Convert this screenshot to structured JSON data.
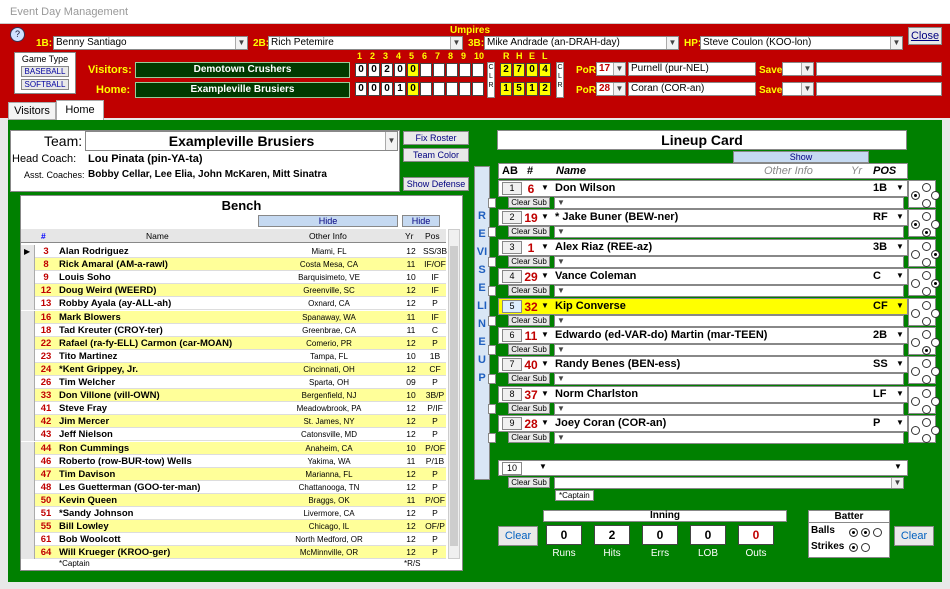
{
  "window_title": "Event Day Management",
  "umpires": {
    "header": "Umpires",
    "first_label": "1B:",
    "first": "Benny Santiago",
    "second_label": "2B:",
    "second": "Rich Petemire",
    "third_label": "3B:",
    "third": "Mike Andrade (an-DRAH-day)",
    "home_label": "HP:",
    "home": "Steve Coulon (KOO-lon)"
  },
  "close_label": "Close",
  "game_type": {
    "title": "Game Type",
    "options": [
      "BASEBALL",
      "SOFTBALL"
    ]
  },
  "scoreboard": {
    "inning_headers": [
      "1",
      "2",
      "3",
      "4",
      "5",
      "6",
      "7",
      "8",
      "9",
      "10"
    ],
    "rhel_headers": [
      "R",
      "H",
      "E",
      "L"
    ],
    "clr": "C L R",
    "visitors_label": "Visitors:",
    "visitors_team": "Demotown Crushers",
    "visitors_innings": [
      "0",
      "0",
      "2",
      "0",
      "0",
      "",
      "",
      "",
      "",
      ""
    ],
    "visitors_rhel": [
      "2",
      "7",
      "0",
      "4"
    ],
    "home_label": "Home:",
    "home_team": "Exampleville Brusiers",
    "home_innings": [
      "0",
      "0",
      "0",
      "1",
      "0",
      "",
      "",
      "",
      "",
      ""
    ],
    "home_rhel": [
      "1",
      "5",
      "1",
      "2"
    ],
    "por_label": "PoR:",
    "save_label": "Save:",
    "visitors_por_num": "17",
    "visitors_por_name": "Purnell (pur-NEL)",
    "home_por_num": "28",
    "home_por_name": "Coran (COR-an)"
  },
  "tabs": [
    "Visitors",
    "Home"
  ],
  "team": {
    "label": "Team:",
    "name": "Exampleville Brusiers",
    "head_coach_label": "Head Coach:",
    "head_coach": "Lou Pinata (pin-YA-ta)",
    "asst_label": "Asst. Coaches:",
    "asst": "Bobby Cellar, Lee Elia, John McKaren, Mitt Sinatra"
  },
  "buttons": {
    "fix_roster": "Fix Roster",
    "team_color": "Team Color",
    "show_defense": "Show Defense",
    "hide": "Hide",
    "show": "Show",
    "clear": "Clear",
    "clear_sub": "Clear Sub"
  },
  "bench": {
    "title": "Bench",
    "headers": [
      "#",
      "Name",
      "Other Info",
      "Yr",
      "Pos"
    ],
    "footer_left": "*Captain",
    "footer_right": "*R/S",
    "rows": [
      {
        "num": "3",
        "name": "Alan Rodriguez",
        "info": "Miami, FL",
        "yr": "12",
        "pos": "SS/3B",
        "hl": false
      },
      {
        "num": "8",
        "name": "Rick Amaral (AM-a-rawl)",
        "info": "Costa Mesa, CA",
        "yr": "11",
        "pos": "IF/OF",
        "hl": true
      },
      {
        "num": "9",
        "name": "Louis Soho",
        "info": "Barquisimeto, VE",
        "yr": "10",
        "pos": "IF",
        "hl": false
      },
      {
        "num": "12",
        "name": "Doug Weird (WEERD)",
        "info": "Greenville, SC",
        "yr": "12",
        "pos": "IF",
        "hl": true
      },
      {
        "num": "13",
        "name": "Robby Ayala (ay-ALL-ah)",
        "info": "Oxnard, CA",
        "yr": "12",
        "pos": "P",
        "hl": false
      },
      {
        "num": "16",
        "name": "Mark Blowers",
        "info": "Spanaway, WA",
        "yr": "11",
        "pos": "IF",
        "hl": true
      },
      {
        "num": "18",
        "name": "Tad Kreuter (CROY-ter)",
        "info": "Greenbrae, CA",
        "yr": "11",
        "pos": "C",
        "hl": false
      },
      {
        "num": "22",
        "name": "Rafael (ra-fy-ELL) Carmon (car-MOAN)",
        "info": "Comerio, PR",
        "yr": "12",
        "pos": "P",
        "hl": true
      },
      {
        "num": "23",
        "name": "Tito Martinez",
        "info": "Tampa, FL",
        "yr": "10",
        "pos": "1B",
        "hl": false
      },
      {
        "num": "24",
        "name": "*Kent Grippey, Jr.",
        "info": "Cincinnati, OH",
        "yr": "12",
        "pos": "CF",
        "hl": true
      },
      {
        "num": "26",
        "name": "Tim Welcher",
        "info": "Sparta, OH",
        "yr": "09",
        "pos": "P",
        "hl": false
      },
      {
        "num": "33",
        "name": "Don Villone (vill-OWN)",
        "info": "Bergenfield, NJ",
        "yr": "10",
        "pos": "3B/P",
        "hl": true
      },
      {
        "num": "41",
        "name": "Steve Fray",
        "info": "Meadowbrook, PA",
        "yr": "12",
        "pos": "P/IF",
        "hl": false
      },
      {
        "num": "42",
        "name": "Jim Mercer",
        "info": "St. James, NY",
        "yr": "12",
        "pos": "P",
        "hl": true
      },
      {
        "num": "43",
        "name": "Jeff Nielson",
        "info": "Catonsville, MD",
        "yr": "12",
        "pos": "P",
        "hl": false
      },
      {
        "num": "44",
        "name": "Ron Cummings",
        "info": "Anaheim, CA",
        "yr": "10",
        "pos": "P/OF",
        "hl": true
      },
      {
        "num": "46",
        "name": "Roberto (row-BUR-tow) Wells",
        "info": "Yakima, WA",
        "yr": "11",
        "pos": "P/1B",
        "hl": false
      },
      {
        "num": "47",
        "name": "Tim Davison",
        "info": "Marianna, FL",
        "yr": "12",
        "pos": "P",
        "hl": true
      },
      {
        "num": "48",
        "name": "Les Guetterman (GOO-ter-man)",
        "info": "Chattanooga, TN",
        "yr": "12",
        "pos": "P",
        "hl": false
      },
      {
        "num": "50",
        "name": "Kevin Queen",
        "info": "Braggs, OK",
        "yr": "11",
        "pos": "P/OF",
        "hl": true
      },
      {
        "num": "51",
        "name": "*Sandy Johnson",
        "info": "Livermore, CA",
        "yr": "12",
        "pos": "P",
        "hl": false
      },
      {
        "num": "55",
        "name": "Bill Lowley",
        "info": "Chicago, IL",
        "yr": "12",
        "pos": "OF/P",
        "hl": true
      },
      {
        "num": "61",
        "name": "Bob Woolcott",
        "info": "North Medford, OR",
        "yr": "12",
        "pos": "P",
        "hl": false
      },
      {
        "num": "64",
        "name": "Will Krueger (KROO-ger)",
        "info": "McMinnville, OR",
        "yr": "12",
        "pos": "P",
        "hl": true
      }
    ]
  },
  "revise_lineup": "REVISE LINEUP",
  "lineup": {
    "title": "Lineup Card",
    "headers": [
      "AB",
      "#",
      "Name",
      "Other Info",
      "Yr",
      "POS"
    ],
    "footer": "*Captain",
    "rows": [
      {
        "ab": "1",
        "num": "6",
        "name": "Don Wilson",
        "pos": "1B",
        "hl": false
      },
      {
        "ab": "2",
        "num": "19",
        "name": "* Jake Buner (BEW-ner)",
        "pos": "RF",
        "hl": false
      },
      {
        "ab": "3",
        "num": "1",
        "name": "Alex Riaz (REE-az)",
        "pos": "3B",
        "hl": false
      },
      {
        "ab": "4",
        "num": "29",
        "name": "Vance Coleman",
        "pos": "C",
        "hl": false
      },
      {
        "ab": "5",
        "num": "32",
        "name": "Kip Converse",
        "pos": "CF",
        "hl": true
      },
      {
        "ab": "6",
        "num": "11",
        "name": "Edwardo (ed-VAR-do) Martin (mar-TEEN)",
        "pos": "2B",
        "hl": false
      },
      {
        "ab": "7",
        "num": "40",
        "name": "Randy Benes (BEN-ess)",
        "pos": "SS",
        "hl": false
      },
      {
        "ab": "8",
        "num": "37",
        "name": "Norm Charlston",
        "pos": "LF",
        "hl": false
      },
      {
        "ab": "9",
        "num": "28",
        "name": "Joey Coran (COR-an)",
        "pos": "P",
        "hl": false
      }
    ],
    "extra_ab": "10"
  },
  "inning": {
    "title": "Inning",
    "labels": [
      "Runs",
      "Hits",
      "Errs",
      "LOB",
      "Outs"
    ],
    "values": [
      "0",
      "2",
      "0",
      "0",
      "0"
    ]
  },
  "batter": {
    "title": "Batter",
    "balls_label": "Balls",
    "strikes_label": "Strikes"
  }
}
